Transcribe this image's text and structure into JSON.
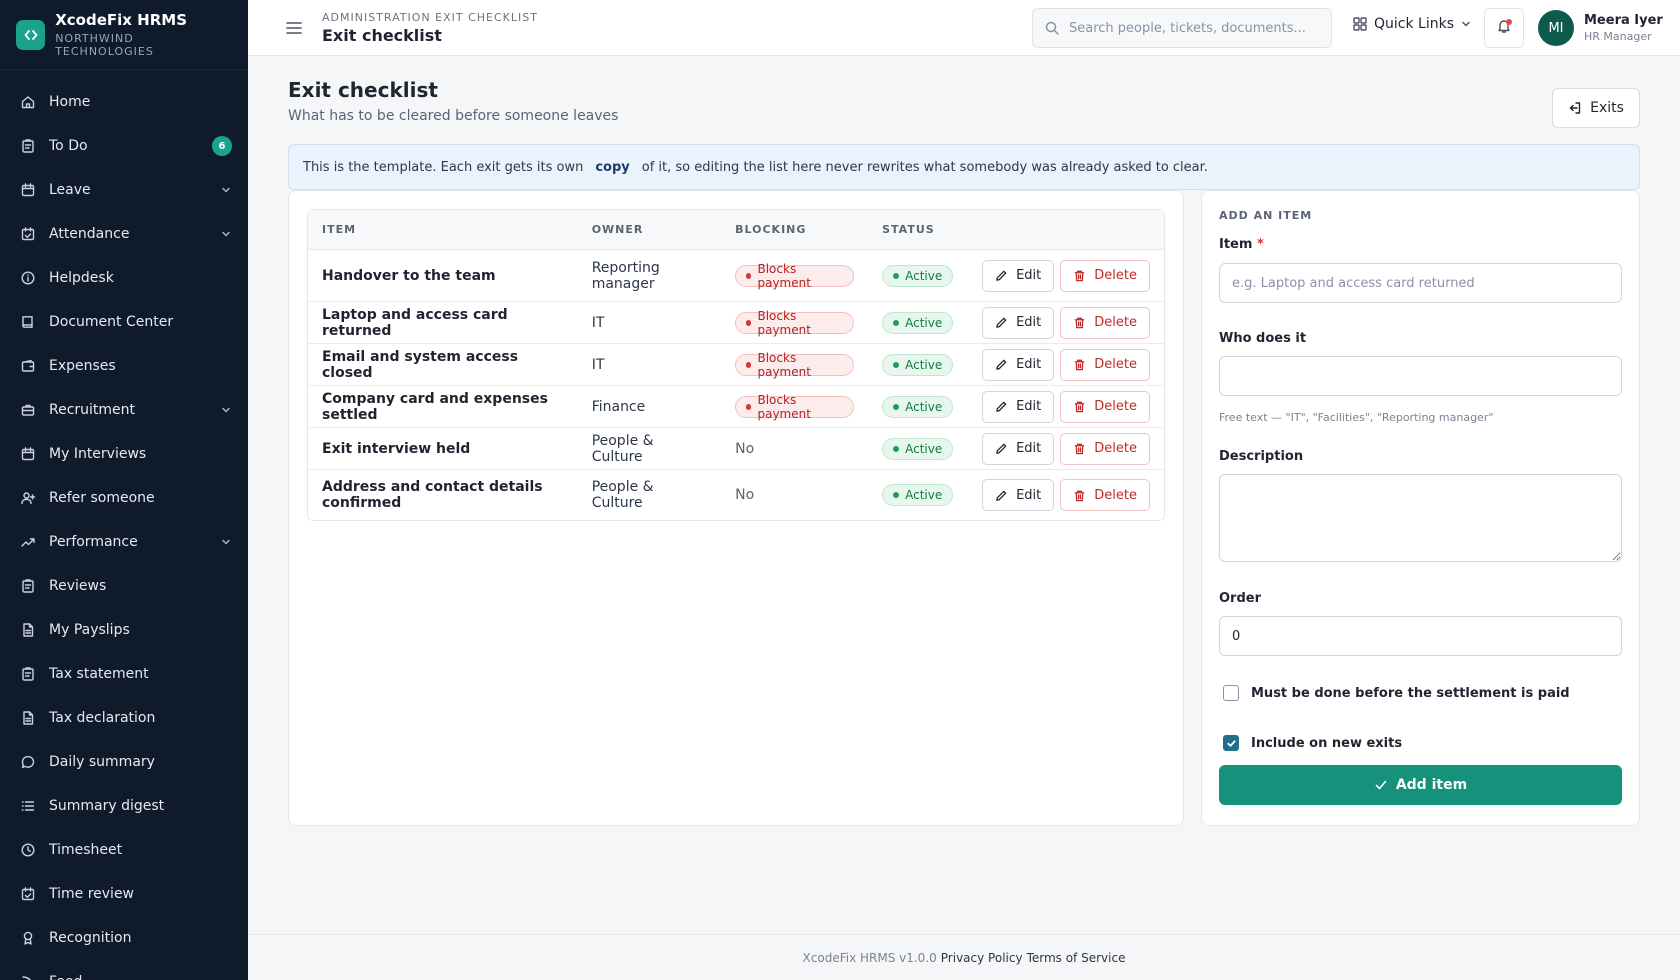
{
  "brand": {
    "name": "XcodeFix HRMS",
    "org": "NORTHWIND TECHNOLOGIES"
  },
  "sidebar": {
    "items": [
      {
        "label": "Home",
        "icon": "home-icon"
      },
      {
        "label": "To Do",
        "icon": "clipboard-icon",
        "badge": "6"
      },
      {
        "label": "Leave",
        "icon": "calendar-icon",
        "expandable": true
      },
      {
        "label": "Attendance",
        "icon": "calendar-check-icon",
        "expandable": true
      },
      {
        "label": "Helpdesk",
        "icon": "info-icon"
      },
      {
        "label": "Document Center",
        "icon": "book-icon"
      },
      {
        "label": "Expenses",
        "icon": "wallet-icon"
      },
      {
        "label": "Recruitment",
        "icon": "briefcase-icon",
        "expandable": true
      },
      {
        "label": "My Interviews",
        "icon": "calendar-icon"
      },
      {
        "label": "Refer someone",
        "icon": "user-plus-icon"
      },
      {
        "label": "Performance",
        "icon": "trend-up-icon",
        "expandable": true
      },
      {
        "label": "Reviews",
        "icon": "clipboard-icon"
      },
      {
        "label": "My Payslips",
        "icon": "file-icon"
      },
      {
        "label": "Tax statement",
        "icon": "clipboard-icon"
      },
      {
        "label": "Tax declaration",
        "icon": "file-icon"
      },
      {
        "label": "Daily summary",
        "icon": "chat-icon"
      },
      {
        "label": "Summary digest",
        "icon": "list-icon"
      },
      {
        "label": "Timesheet",
        "icon": "clock-icon"
      },
      {
        "label": "Time review",
        "icon": "calendar-check-icon"
      },
      {
        "label": "Recognition",
        "icon": "award-icon"
      },
      {
        "label": "Feed",
        "icon": "rss-icon"
      }
    ]
  },
  "topbar": {
    "breadcrumb": "ADMINISTRATION EXIT CHECKLIST",
    "title": "Exit checklist",
    "search_placeholder": "Search people, tickets, documents...",
    "quick_links": "Quick Links",
    "user": {
      "initials": "MI",
      "name": "Meera Iyer",
      "role": "HR Manager"
    }
  },
  "page": {
    "title": "Exit checklist",
    "subtitle": "What has to be cleared before someone leaves",
    "exits_button": "Exits",
    "info": {
      "before": "This is the template. Each exit gets its own",
      "code": "copy",
      "after": "of it, so editing the list here never rewrites what somebody was already asked to clear."
    }
  },
  "table": {
    "headers": [
      "ITEM",
      "OWNER",
      "BLOCKING",
      "STATUS"
    ],
    "edit_label": "Edit",
    "delete_label": "Delete",
    "rows": [
      {
        "item": "Handover to the team",
        "owner": "Reporting manager",
        "blocking": "Blocks payment",
        "blocks": true,
        "status": "Active"
      },
      {
        "item": "Laptop and access card returned",
        "owner": "IT",
        "blocking": "Blocks payment",
        "blocks": true,
        "status": "Active"
      },
      {
        "item": "Email and system access closed",
        "owner": "IT",
        "blocking": "Blocks payment",
        "blocks": true,
        "status": "Active"
      },
      {
        "item": "Company card and expenses settled",
        "owner": "Finance",
        "blocking": "Blocks payment",
        "blocks": true,
        "status": "Active"
      },
      {
        "item": "Exit interview held",
        "owner": "People & Culture",
        "blocking": "No",
        "blocks": false,
        "status": "Active"
      },
      {
        "item": "Address and contact details confirmed",
        "owner": "People & Culture",
        "blocking": "No",
        "blocks": false,
        "status": "Active"
      }
    ]
  },
  "form": {
    "title": "ADD AN ITEM",
    "item_label": "Item",
    "item_placeholder": "e.g. Laptop and access card returned",
    "who_label": "Who does it",
    "who_value": "",
    "who_hint": "Free text — \"IT\", \"Facilities\", \"Reporting manager\"",
    "description_label": "Description",
    "order_label": "Order",
    "order_value": "0",
    "blocking_label": "Must be done before the settlement is paid",
    "blocking_checked": false,
    "include_label": "Include on new exits",
    "include_checked": true,
    "submit_label": "Add item"
  },
  "footer": {
    "version": "XcodeFix HRMS v1.0.0",
    "privacy": "Privacy Policy",
    "terms": "Terms of Service"
  },
  "colors": {
    "sidebar_bg": "#0f1a2b",
    "accent": "#16917c",
    "danger": "#c02a2a",
    "success": "#137a43"
  }
}
